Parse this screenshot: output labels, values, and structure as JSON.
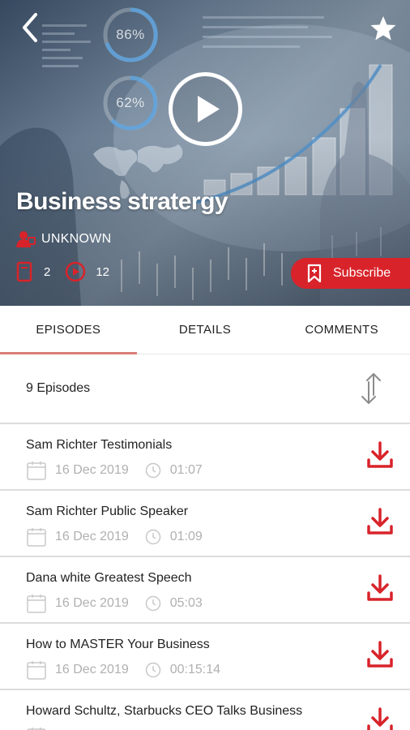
{
  "colors": {
    "accent": "#d8232a",
    "tab_indicator": "#d97d78",
    "muted": "#b0b0b0",
    "divider": "#dcdcdc"
  },
  "hero": {
    "title": "Business stratergy",
    "author": "UNKNOWN",
    "stat_rings": [
      "86%",
      "62%"
    ],
    "counts": {
      "subscribers": "2",
      "plays": "12"
    },
    "subscribe_label": "Subscribe",
    "icons": {
      "back": "chevron-left-icon",
      "favorite": "star-icon",
      "play": "play-icon"
    }
  },
  "tabs": [
    {
      "label": "EPISODES",
      "active": true
    },
    {
      "label": "DETAILS",
      "active": false
    },
    {
      "label": "COMMENTS",
      "active": false
    }
  ],
  "episodes_header": {
    "count_label": "9 Episodes",
    "sort_icon": "sort-arrows-icon"
  },
  "episodes": [
    {
      "title": "Sam Richter Testimonials",
      "date": "16 Dec 2019",
      "duration": "01:07"
    },
    {
      "title": "Sam Richter Public Speaker",
      "date": "16 Dec 2019",
      "duration": "01:09"
    },
    {
      "title": "Dana white Greatest Speech",
      "date": "16 Dec 2019",
      "duration": "05:03"
    },
    {
      "title": "How to MASTER Your Business",
      "date": "16 Dec 2019",
      "duration": "00:15:14"
    },
    {
      "title": "Howard Schultz, Starbucks CEO Talks Business",
      "date": "",
      "duration": ""
    }
  ]
}
